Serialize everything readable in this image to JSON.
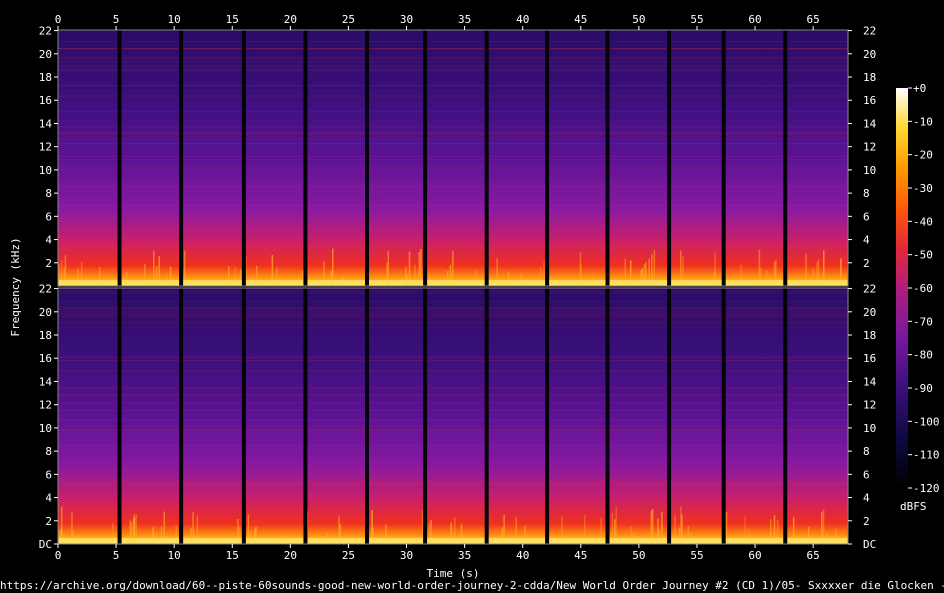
{
  "chart_data": {
    "type": "heatmap",
    "title": "",
    "xlabel": "Time (s)",
    "ylabel": "Frequency (kHz)",
    "colorbar_label": "dBFS",
    "xlim": [
      0,
      68
    ],
    "ylim": [
      0,
      22.05
    ],
    "x_ticks": [
      0,
      5,
      10,
      15,
      20,
      25,
      30,
      35,
      40,
      45,
      50,
      55,
      60,
      65
    ],
    "y_ticks": [
      0,
      2,
      4,
      6,
      8,
      10,
      12,
      14,
      16,
      18,
      20,
      22
    ],
    "y_tick_labels": [
      "DC",
      "2",
      "4",
      "6",
      "8",
      "10",
      "12",
      "14",
      "16",
      "18",
      "20",
      "22"
    ],
    "colorbar_ticks": [
      "+0",
      "-10",
      "-20",
      "-30",
      "-40",
      "-50",
      "-60",
      "-70",
      "-80",
      "-90",
      "-100",
      "-110",
      "-120"
    ],
    "colorbar_range": [
      -120,
      0
    ],
    "channels": [
      "upper",
      "lower"
    ],
    "segment_boundaries_s": [
      5.3,
      10.6,
      16.0,
      21.3,
      26.6,
      31.6,
      36.9,
      42.1,
      47.3,
      52.6,
      57.3,
      62.6
    ],
    "colormap": [
      "#000000",
      "#1a0a4a",
      "#4b0f8a",
      "#8a1aa0",
      "#c8206a",
      "#f0301e",
      "#ff7a00",
      "#ffc020",
      "#ffff90",
      "#ffffff"
    ]
  },
  "source_url": "https://archive.org/download/60--piste-60sounds-good-new-world-order-journey-2-cdda/New World Order Journey #2 (CD 1)/05- Sxxxxer die Glocken - A.wav"
}
